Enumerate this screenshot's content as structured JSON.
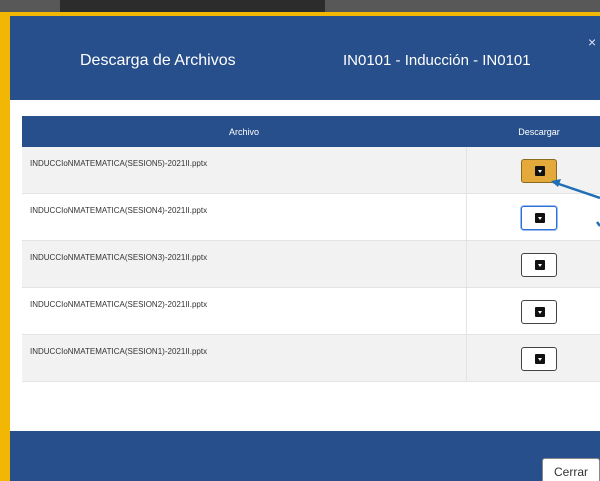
{
  "modal": {
    "title": "Descarga de Archivos",
    "course": "IN0101 - Inducción - IN0101",
    "close_symbol": "×"
  },
  "table": {
    "headers": [
      "Archivo",
      "Descargar"
    ],
    "rows": [
      {
        "file": "INDUCCIoNMATEMATICA(SESION5)-2021II.pptx"
      },
      {
        "file": "INDUCCIoNMATEMATICA(SESION4)-2021II.pptx"
      },
      {
        "file": "INDUCCIoNMATEMATICA(SESION3)-2021II.pptx"
      },
      {
        "file": "INDUCCIoNMATEMATICA(SESION2)-2021II.pptx"
      },
      {
        "file": "INDUCCIoNMATEMATICA(SESION1)-2021II.pptx"
      }
    ]
  },
  "footer": {
    "close_label": "Cerrar"
  },
  "icons": {
    "download": "download-box-icon"
  },
  "colors": {
    "header_bg": "#274f8b",
    "highlight_frame": "#f2b705",
    "active_button": "#e3a93a",
    "annotation_arrow": "#1f6fb5"
  }
}
